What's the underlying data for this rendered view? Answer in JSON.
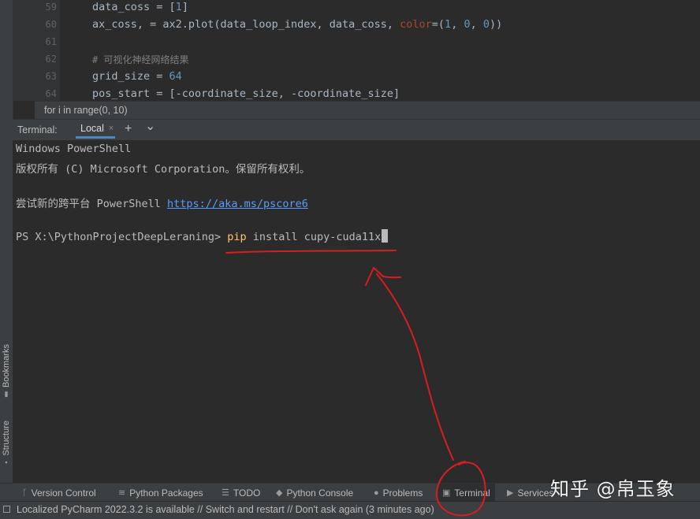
{
  "editor": {
    "line_numbers": [
      "59",
      "60",
      "61",
      "62",
      "63",
      "64"
    ],
    "code": {
      "l59_a": "data_coss = [",
      "l59_num": "1",
      "l59_b": "]",
      "l60_a": "ax_coss, = ax2.plot(data_loop_index, data_coss, ",
      "l60_param": "color",
      "l60_b": "=(",
      "l60_n1": "1",
      "l60_c1": ", ",
      "l60_n2": "0",
      "l60_c2": ", ",
      "l60_n3": "0",
      "l60_d": "))",
      "l62_comment": "# 可视化神经网络结果",
      "l63_a": "grid_size = ",
      "l63_num": "64",
      "l64": "pos_start = [-coordinate_size, -coordinate_size]"
    },
    "breadcrumb": "for i in range(0, 10)"
  },
  "terminal": {
    "title": "Terminal:",
    "tab_label": "Local",
    "tab_close": "×",
    "add_icon": "+",
    "dropdown_icon": "⌄",
    "lines": {
      "line1": "Windows PowerShell",
      "line2": "版权所有 (C) Microsoft Corporation。保留所有权利。",
      "line3_text": "尝试新的跨平台 PowerShell ",
      "line3_link": "https://aka.ms/pscore6",
      "prompt": "PS X:\\PythonProjectDeepLeraning> ",
      "cmd": "pip",
      "args": " install cupy-cuda11x"
    }
  },
  "side_tools": {
    "bookmarks": "Bookmarks",
    "structure": "Structure"
  },
  "toolbar": {
    "version_control": "Version Control",
    "python_packages": "Python Packages",
    "todo": "TODO",
    "python_console": "Python Console",
    "problems": "Problems",
    "terminal": "Terminal",
    "services": "Services"
  },
  "status": {
    "message": "Localized PyCharm 2022.3.2 is available // Switch and restart // Don't ask again (3 minutes ago)"
  },
  "watermark": "知乎 @帛玉象",
  "colors": {
    "background": "#2b2b2b",
    "panel": "#3c3f41",
    "annotation": "#d81e1e",
    "link": "#589df6",
    "number": "#6897bb",
    "keyword": "#cc7832"
  }
}
